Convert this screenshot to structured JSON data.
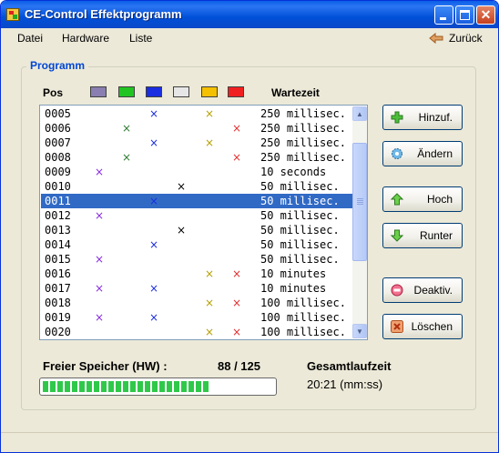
{
  "window": {
    "title": "CE-Control Effektprogramm",
    "controls": {
      "minimize": "minimize-icon",
      "maximize": "maximize-icon",
      "close": "✕"
    }
  },
  "menu": {
    "items": [
      "Datei",
      "Hardware",
      "Liste"
    ],
    "back_label": "Zurück"
  },
  "group": {
    "title": "Programm",
    "pos_header": "Pos",
    "wait_header": "Wartezeit",
    "channel_colors": [
      "#8a7fb0",
      "#22c422",
      "#1b2ee0",
      "#e6e6e6",
      "#f5c000",
      "#f02020"
    ]
  },
  "list": {
    "mark_colors": [
      "#8a2be2",
      "#2e7d32",
      "#1b2ee0",
      "#000000",
      "#b8a000",
      "#e03030"
    ],
    "selected_index": 6,
    "rows": [
      {
        "pos": "0005",
        "channels": [
          0,
          0,
          1,
          0,
          1,
          0
        ],
        "wait": "250 millisec."
      },
      {
        "pos": "0006",
        "channels": [
          0,
          1,
          0,
          0,
          0,
          1
        ],
        "wait": "250 millisec."
      },
      {
        "pos": "0007",
        "channels": [
          0,
          0,
          1,
          0,
          1,
          0
        ],
        "wait": "250 millisec."
      },
      {
        "pos": "0008",
        "channels": [
          0,
          1,
          0,
          0,
          0,
          1
        ],
        "wait": "250 millisec."
      },
      {
        "pos": "0009",
        "channels": [
          1,
          0,
          0,
          0,
          0,
          0
        ],
        "wait": "10 seconds"
      },
      {
        "pos": "0010",
        "channels": [
          0,
          0,
          0,
          1,
          0,
          0
        ],
        "wait": "50 millisec."
      },
      {
        "pos": "0011",
        "channels": [
          0,
          0,
          1,
          0,
          0,
          0
        ],
        "wait": "50 millisec."
      },
      {
        "pos": "0012",
        "channels": [
          1,
          0,
          0,
          0,
          0,
          0
        ],
        "wait": "50 millisec."
      },
      {
        "pos": "0013",
        "channels": [
          0,
          0,
          0,
          1,
          0,
          0
        ],
        "wait": "50 millisec."
      },
      {
        "pos": "0014",
        "channels": [
          0,
          0,
          1,
          0,
          0,
          0
        ],
        "wait": "50 millisec."
      },
      {
        "pos": "0015",
        "channels": [
          1,
          0,
          0,
          0,
          0,
          0
        ],
        "wait": "50 millisec."
      },
      {
        "pos": "0016",
        "channels": [
          0,
          0,
          0,
          0,
          1,
          1
        ],
        "wait": "10 minutes"
      },
      {
        "pos": "0017",
        "channels": [
          1,
          0,
          1,
          0,
          0,
          0
        ],
        "wait": "10 minutes"
      },
      {
        "pos": "0018",
        "channels": [
          0,
          0,
          0,
          0,
          1,
          1
        ],
        "wait": "100 millisec."
      },
      {
        "pos": "0019",
        "channels": [
          1,
          0,
          1,
          0,
          0,
          0
        ],
        "wait": "100 millisec."
      },
      {
        "pos": "0020",
        "channels": [
          0,
          0,
          0,
          0,
          1,
          1
        ],
        "wait": "100 millisec."
      }
    ]
  },
  "buttons": {
    "add": "Hinzuf.",
    "edit": "Ändern",
    "up": "Hoch",
    "down": "Runter",
    "deactivate": "Deaktiv.",
    "delete": "Löschen"
  },
  "memory": {
    "label": "Freier Speicher (HW) :",
    "value_text": "88 / 125",
    "fill_fraction": 0.72
  },
  "runtime": {
    "label": "Gesamtlaufzeit",
    "value": "20:21 (mm:ss)"
  }
}
